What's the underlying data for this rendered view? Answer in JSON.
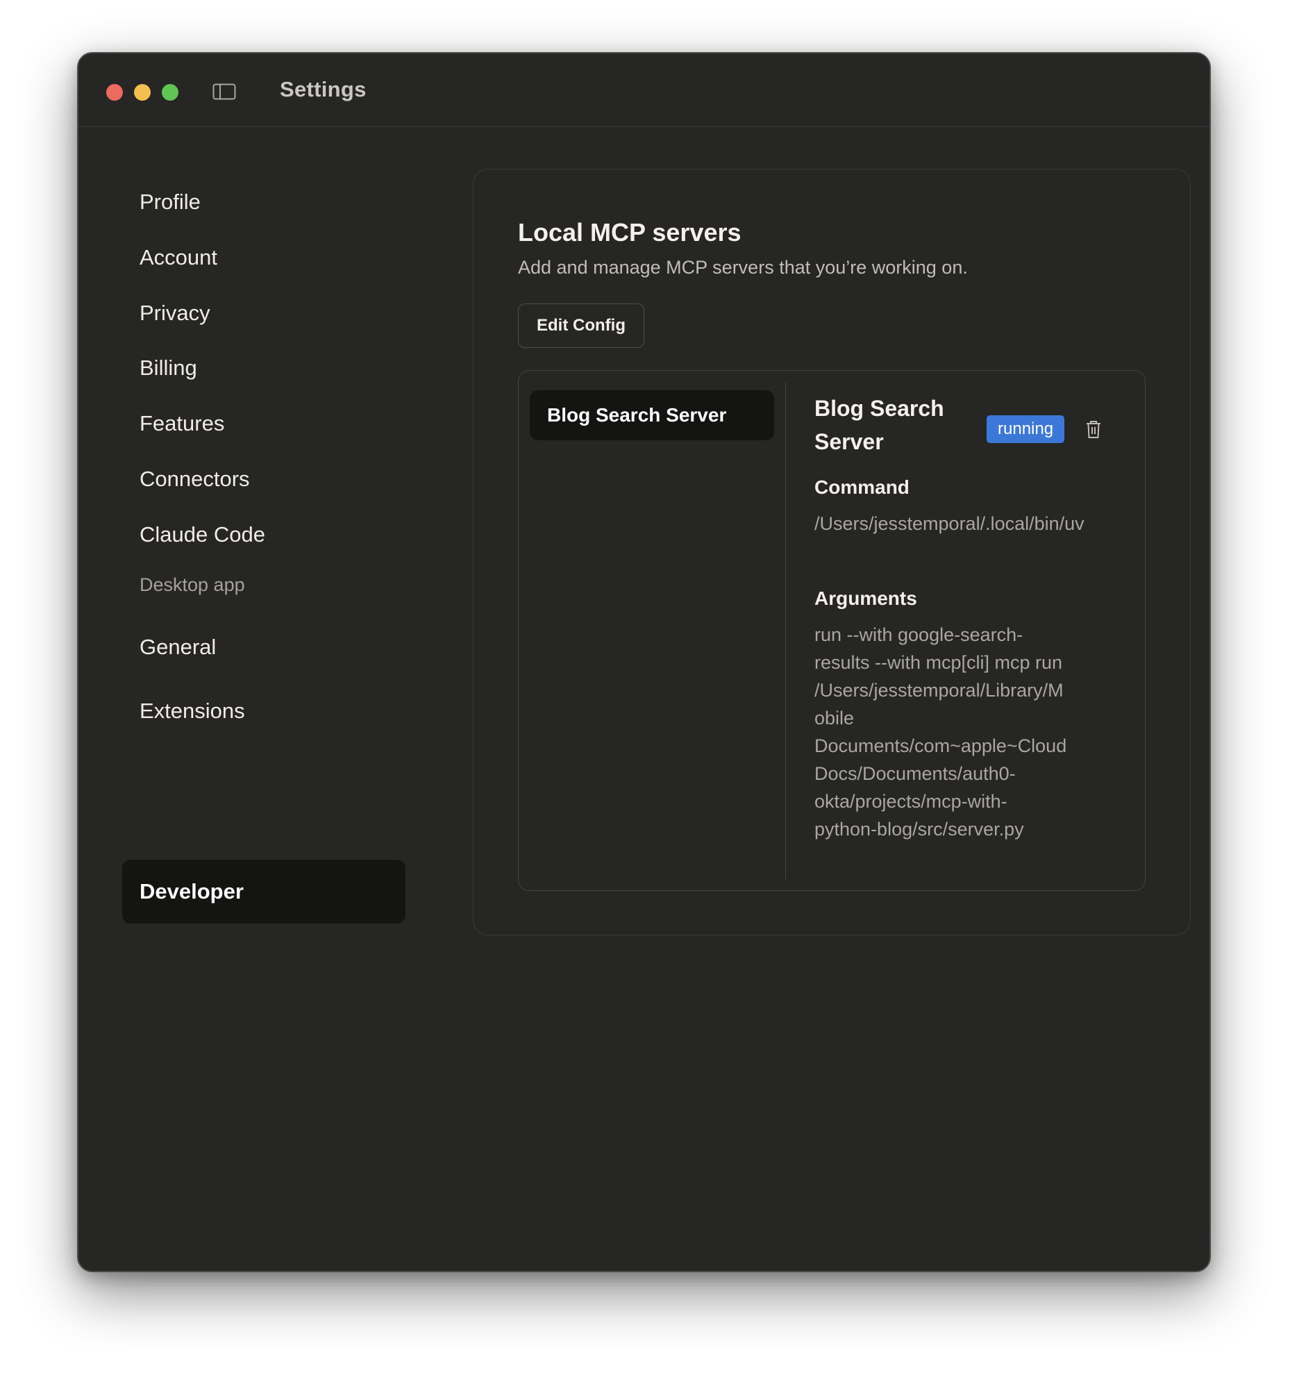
{
  "window": {
    "title": "Settings"
  },
  "sidebar": {
    "items": [
      {
        "label": "Profile"
      },
      {
        "label": "Account"
      },
      {
        "label": "Privacy"
      },
      {
        "label": "Billing"
      },
      {
        "label": "Features"
      },
      {
        "label": "Connectors"
      },
      {
        "label": "Claude Code"
      }
    ],
    "section_label": "Desktop app",
    "app_items": [
      {
        "label": "General"
      },
      {
        "label": "Extensions"
      },
      {
        "label": "Developer",
        "active": true
      }
    ]
  },
  "main": {
    "title": "Local MCP servers",
    "subtitle": "Add and manage MCP servers that you’re working on.",
    "edit_config_label": "Edit Config",
    "servers": [
      {
        "name": "Blog Search Server"
      }
    ],
    "detail": {
      "name": "Blog Search Server",
      "status": "running",
      "command_label": "Command",
      "command_value": "/Users/jesstemporal/.local/bin/uv",
      "arguments_label": "Arguments",
      "arguments_lines": [
        "run --with google-search-",
        "results --with mcp[cli] mcp run",
        "/Users/jesstemporal/Library/M",
        "obile",
        "Documents/com~apple~Cloud",
        "Docs/Documents/auth0-",
        "okta/projects/mcp-with-",
        "python-blog/src/server.py"
      ]
    }
  },
  "icons": {
    "sidebar_toggle": "sidebar-toggle-icon",
    "delete": "trash-icon"
  },
  "colors": {
    "background": "#262624",
    "active_item": "#141413",
    "badge": "#3c78d8",
    "close": "#ed6a5e",
    "minimize": "#f5bf4f",
    "maximize": "#61c554"
  }
}
